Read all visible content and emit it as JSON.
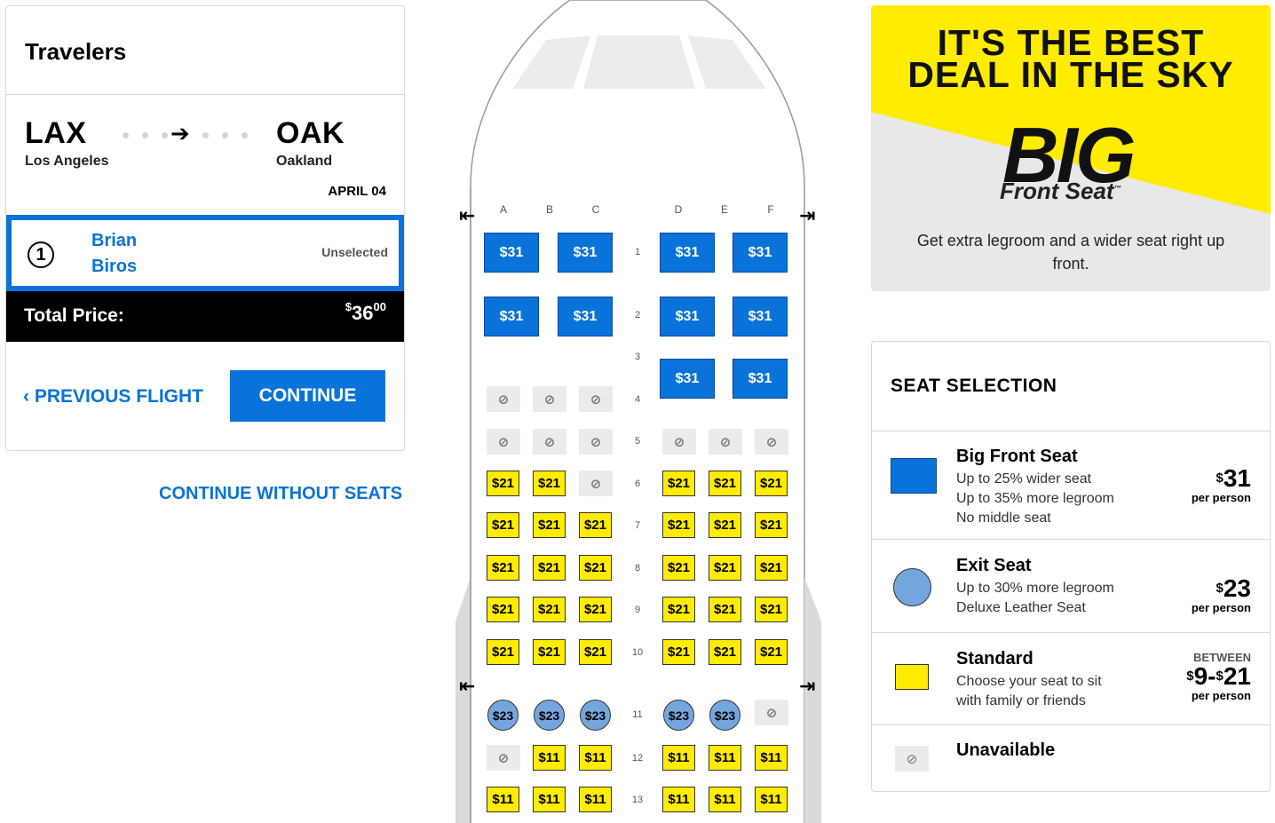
{
  "travelers": {
    "title": "Travelers",
    "origin_code": "LAX",
    "origin_city": "Los Angeles",
    "destination_code": "OAK",
    "destination_city": "Oakland",
    "arrow": "➔",
    "date": "APRIL 04",
    "traveler_number": "1",
    "traveler_first": "Brian",
    "traveler_last": "Biros",
    "traveler_status": "Unselected",
    "total_label": "Total Price:",
    "total_currency": "$",
    "total_whole": "36",
    "total_cents": "00",
    "prev_flight_label": "PREVIOUS FLIGHT",
    "continue_label": "CONTINUE",
    "continue_without_label": "CONTINUE WITHOUT SEATS"
  },
  "seat_map": {
    "columns": [
      "A",
      "B",
      "C",
      "D",
      "E",
      "F"
    ],
    "unavailable_symbol": "⊘",
    "rows": [
      {
        "row": "1",
        "seats": [
          {
            "type": "big",
            "label": "$31"
          },
          {
            "type": "big",
            "label": "$31"
          },
          null,
          {
            "type": "big",
            "label": "$31"
          },
          {
            "type": "big",
            "label": "$31"
          },
          null
        ]
      },
      {
        "row": "2",
        "seats": [
          {
            "type": "big",
            "label": "$31"
          },
          {
            "type": "big",
            "label": "$31"
          },
          null,
          {
            "type": "big",
            "label": "$31"
          },
          {
            "type": "big",
            "label": "$31"
          },
          null
        ]
      },
      {
        "row": "3",
        "seats": [
          null,
          null,
          null,
          {
            "type": "big",
            "label": "$31"
          },
          {
            "type": "big",
            "label": "$31"
          },
          null
        ]
      },
      {
        "row": "4",
        "seats": [
          {
            "type": "unavail"
          },
          {
            "type": "unavail"
          },
          {
            "type": "unavail"
          },
          null,
          null,
          null
        ]
      },
      {
        "row": "5",
        "seats": [
          {
            "type": "unavail"
          },
          {
            "type": "unavail"
          },
          {
            "type": "unavail"
          },
          {
            "type": "unavail"
          },
          {
            "type": "unavail"
          },
          {
            "type": "unavail"
          }
        ]
      },
      {
        "row": "6",
        "seats": [
          {
            "type": "std",
            "label": "$21"
          },
          {
            "type": "std",
            "label": "$21"
          },
          {
            "type": "unavail"
          },
          {
            "type": "std",
            "label": "$21"
          },
          {
            "type": "std",
            "label": "$21"
          },
          {
            "type": "std",
            "label": "$21"
          }
        ]
      },
      {
        "row": "7",
        "seats": [
          {
            "type": "std",
            "label": "$21"
          },
          {
            "type": "std",
            "label": "$21"
          },
          {
            "type": "std",
            "label": "$21"
          },
          {
            "type": "std",
            "label": "$21"
          },
          {
            "type": "std",
            "label": "$21"
          },
          {
            "type": "std",
            "label": "$21"
          }
        ]
      },
      {
        "row": "8",
        "seats": [
          {
            "type": "std",
            "label": "$21"
          },
          {
            "type": "std",
            "label": "$21"
          },
          {
            "type": "std",
            "label": "$21"
          },
          {
            "type": "std",
            "label": "$21"
          },
          {
            "type": "std",
            "label": "$21"
          },
          {
            "type": "std",
            "label": "$21"
          }
        ]
      },
      {
        "row": "9",
        "seats": [
          {
            "type": "std",
            "label": "$21"
          },
          {
            "type": "std",
            "label": "$21"
          },
          {
            "type": "std",
            "label": "$21"
          },
          {
            "type": "std",
            "label": "$21"
          },
          {
            "type": "std",
            "label": "$21"
          },
          {
            "type": "std",
            "label": "$21"
          }
        ]
      },
      {
        "row": "10",
        "seats": [
          {
            "type": "std",
            "label": "$21"
          },
          {
            "type": "std",
            "label": "$21"
          },
          {
            "type": "std",
            "label": "$21"
          },
          {
            "type": "std",
            "label": "$21"
          },
          {
            "type": "std",
            "label": "$21"
          },
          {
            "type": "std",
            "label": "$21"
          }
        ]
      },
      {
        "row": "11",
        "seats": [
          {
            "type": "exit",
            "label": "$23"
          },
          {
            "type": "exit",
            "label": "$23"
          },
          {
            "type": "exit",
            "label": "$23"
          },
          {
            "type": "exit",
            "label": "$23"
          },
          {
            "type": "exit",
            "label": "$23"
          },
          {
            "type": "unavail"
          }
        ]
      },
      {
        "row": "12",
        "seats": [
          {
            "type": "unavail"
          },
          {
            "type": "std",
            "label": "$11"
          },
          {
            "type": "std",
            "label": "$11"
          },
          {
            "type": "std",
            "label": "$11"
          },
          {
            "type": "std",
            "label": "$11"
          },
          {
            "type": "std",
            "label": "$11"
          }
        ]
      },
      {
        "row": "13",
        "seats": [
          {
            "type": "std",
            "label": "$11"
          },
          {
            "type": "std",
            "label": "$11"
          },
          {
            "type": "std",
            "label": "$11"
          },
          {
            "type": "std",
            "label": "$11"
          },
          {
            "type": "std",
            "label": "$11"
          },
          {
            "type": "std",
            "label": "$11"
          }
        ]
      }
    ],
    "exit_left": "⇤",
    "exit_right": "⇥"
  },
  "promo": {
    "line1": "IT'S THE BEST",
    "line2": "DEAL IN THE SKY",
    "big": "BIG",
    "sub": "Front Seat",
    "tm": "™",
    "text": "Get extra legroom and a wider seat right up front."
  },
  "legend": {
    "title": "SEAT SELECTION",
    "items": [
      {
        "name": "Big Front Seat",
        "desc": [
          "Up to 25% wider seat",
          "Up to 35% more legroom",
          "No middle seat"
        ],
        "price": "31",
        "per": "per person",
        "color": "#0a73d9"
      },
      {
        "name": "Exit Seat",
        "desc": [
          "Up to 30% more legroom",
          "Deluxe Leather Seat"
        ],
        "price": "23",
        "per": "per person",
        "color": "#74a6de"
      },
      {
        "name": "Standard",
        "desc": [
          "Choose your seat to sit",
          "with family or friends"
        ],
        "between": "BETWEEN",
        "price_low": "9",
        "price_high": "21",
        "per": "per person",
        "color": "#ffec00"
      },
      {
        "name": "Unavailable",
        "symbol": "⊘",
        "color": "#ebebeb"
      }
    ]
  }
}
